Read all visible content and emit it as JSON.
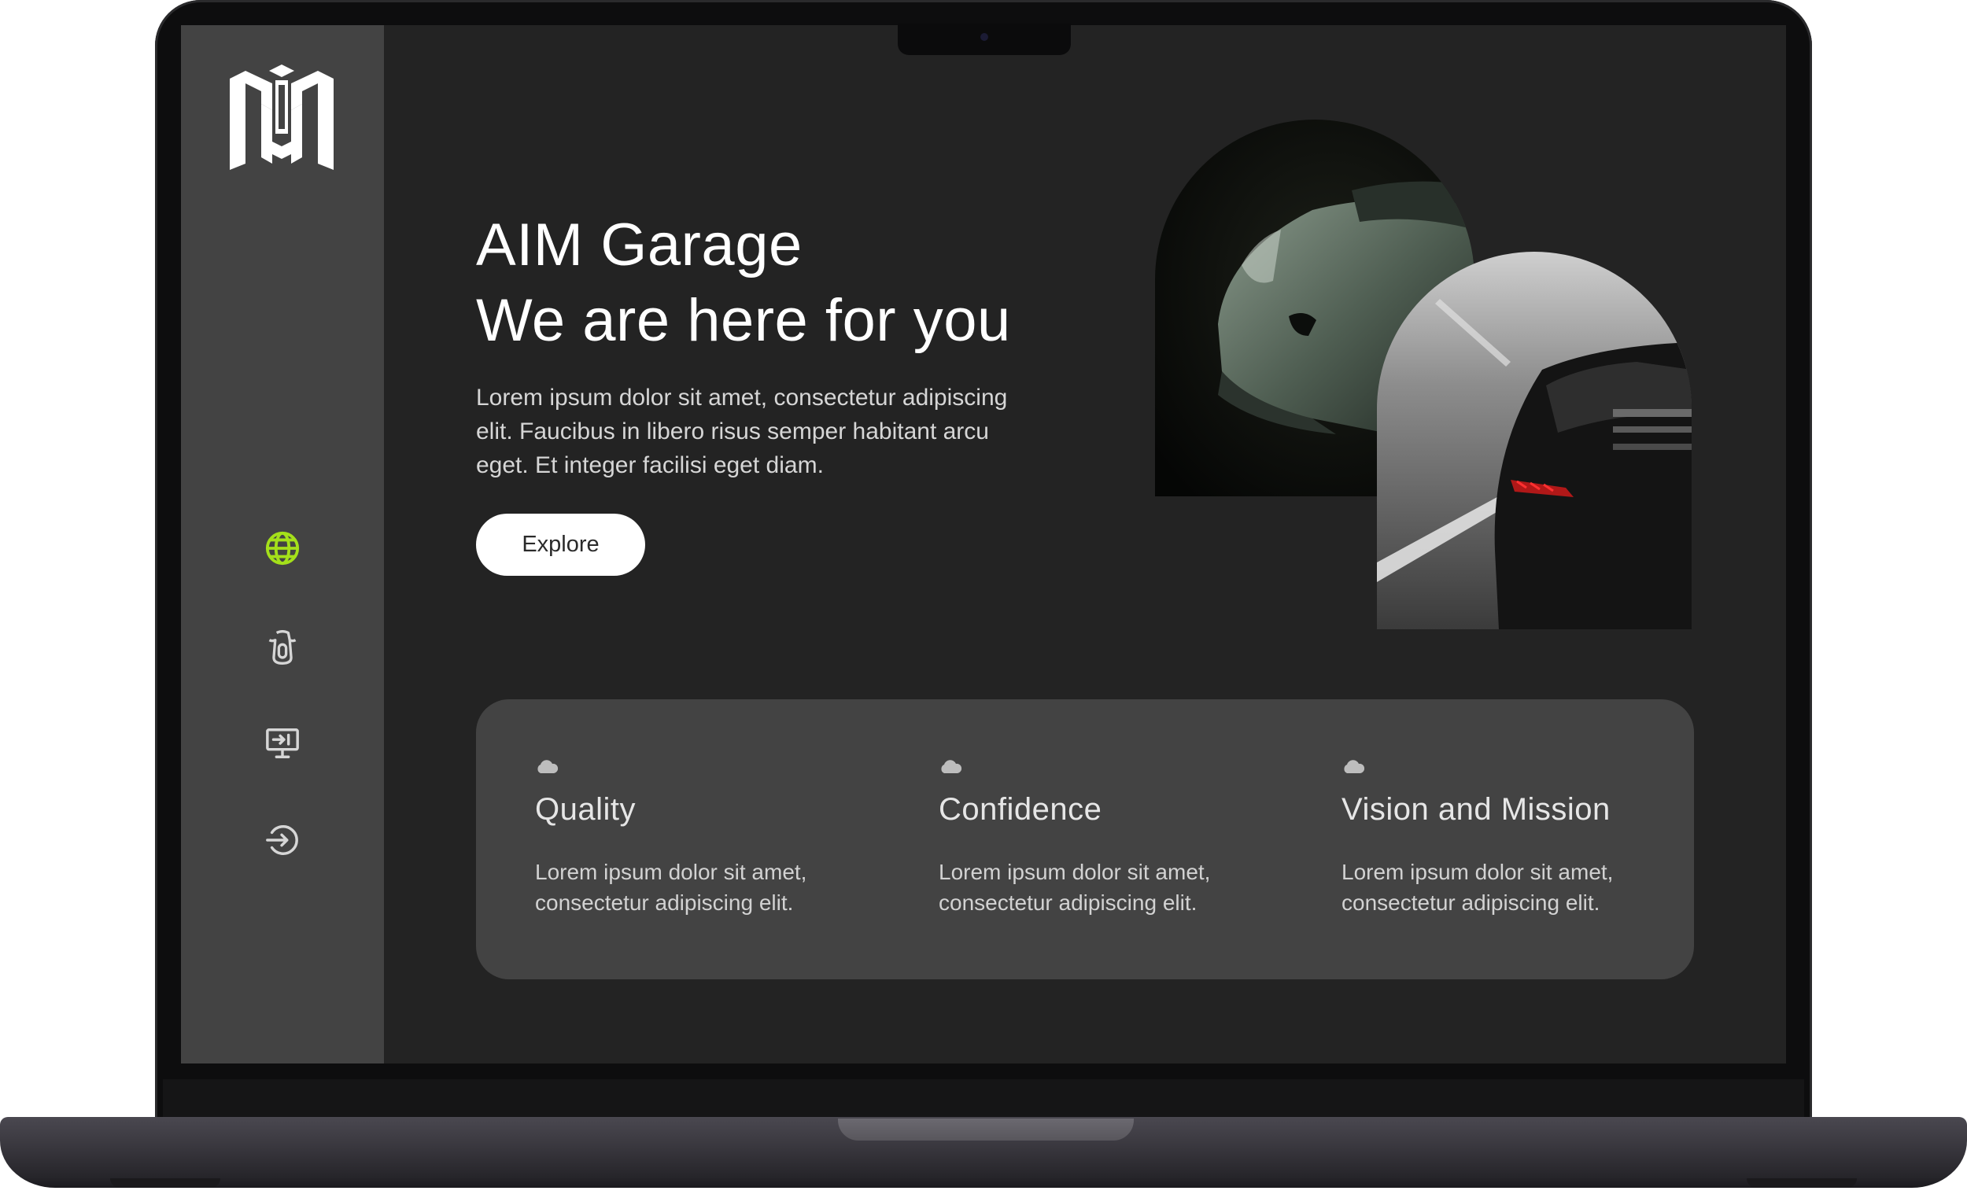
{
  "app": {
    "brand": "AIM"
  },
  "sidebar": {
    "items": [
      {
        "icon": "globe-icon",
        "active": true,
        "color": "#a4e01a"
      },
      {
        "icon": "car-seat-icon",
        "active": false
      },
      {
        "icon": "monitor-icon",
        "active": false
      },
      {
        "icon": "sign-in-icon",
        "active": false
      }
    ]
  },
  "hero": {
    "title_line1": "AIM Garage",
    "title_line2": "We are here for you",
    "description": "Lorem ipsum dolor sit amet, consectetur adipiscing elit. Faucibus in libero risus semper habitant arcu eget. Et integer facilisi eget diam.",
    "cta_label": "Explore"
  },
  "features": [
    {
      "icon": "cloud-icon",
      "title": "Quality",
      "text": "Lorem ipsum dolor sit amet, consectetur adipiscing elit."
    },
    {
      "icon": "cloud-icon",
      "title": "Confidence",
      "text": "Lorem ipsum dolor sit amet, consectetur adipiscing elit."
    },
    {
      "icon": "cloud-icon",
      "title": "Vision and Mission",
      "text": "Lorem ipsum dolor sit amet, consectetur adipiscing elit."
    }
  ],
  "colors": {
    "accent": "#a4e01a",
    "background": "#232323",
    "panel": "#434343",
    "button": "#ffffff"
  }
}
